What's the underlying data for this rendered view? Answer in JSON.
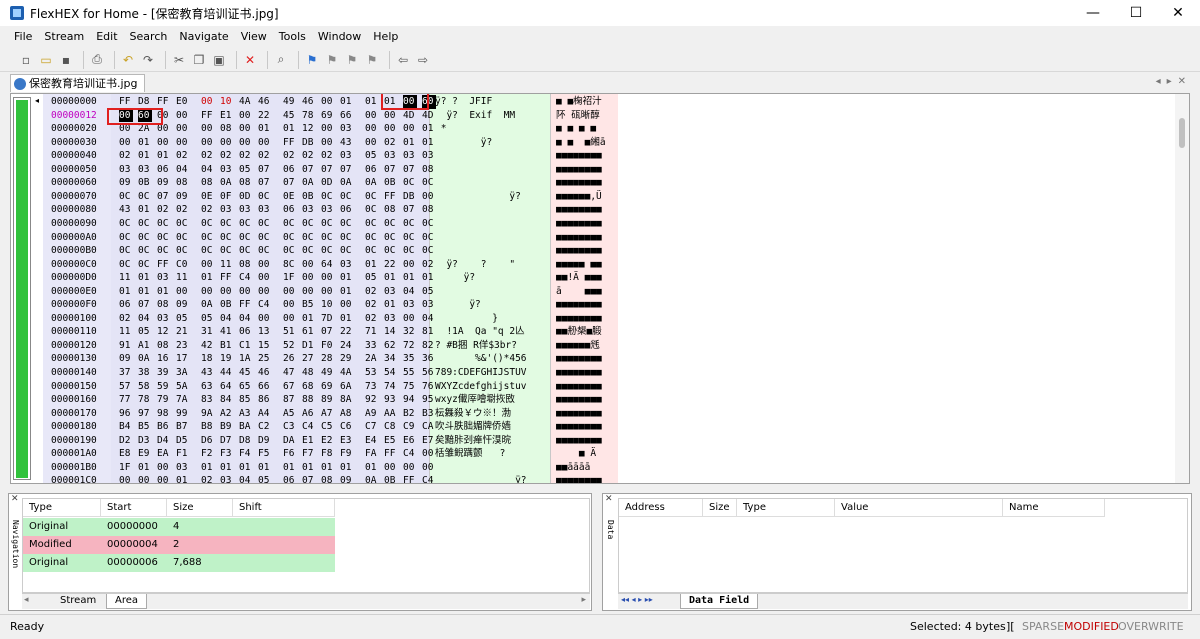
{
  "window": {
    "title": "FlexHEX for Home - [保密教育培训证书.jpg]",
    "controls": [
      "—",
      "☐",
      "✕"
    ]
  },
  "menu": [
    "File",
    "Stream",
    "Edit",
    "Search",
    "Navigate",
    "View",
    "Tools",
    "Window",
    "Help"
  ],
  "toolbar_icons": [
    "new-icon",
    "open-icon",
    "save-icon",
    "print-icon",
    "undo-icon",
    "redo-icon",
    "cut-icon",
    "copy-icon",
    "paste-icon",
    "delete-icon",
    "find-icon",
    "bookmark-icon",
    "bookmark-next-icon",
    "bookmark-prev-icon",
    "bookmark-clear-icon",
    "back-icon",
    "forward-icon"
  ],
  "document_tab": "保密教育培训证书.jpg",
  "hex_rows": [
    {
      "addr": "00000000",
      "hex": [
        "FF",
        "D8",
        "FF",
        "E0",
        "00",
        "10",
        "4A",
        "46",
        "49",
        "46",
        "00",
        "01",
        "01",
        "01",
        "00",
        "60"
      ],
      "ascii": "ÿ? ?  JFIF  ",
      "uni": "■ ■椈祒汁"
    },
    {
      "addr": "00000012",
      "hex": [
        "00",
        "60",
        "00",
        "00",
        "FF",
        "E1",
        "00",
        "22",
        "45",
        "78",
        "69",
        "66",
        "00",
        "00",
        "4D",
        "4D"
      ],
      "ascii": "  ÿ?  Exif  MM",
      "uni": "阫 砙晰醇"
    },
    {
      "addr": "00000020",
      "hex": [
        "00",
        "2A",
        "00",
        "00",
        "00",
        "08",
        "00",
        "01",
        "01",
        "12",
        "00",
        "03",
        "00",
        "00",
        "00",
        "01"
      ],
      "ascii": " *",
      "uni": "■ ■ ■ ■"
    },
    {
      "addr": "00000030",
      "hex": [
        "00",
        "01",
        "00",
        "00",
        "00",
        "00",
        "00",
        "00",
        "FF",
        "DB",
        "00",
        "43",
        "00",
        "02",
        "01",
        "01"
      ],
      "ascii": "        ÿ?",
      "uni": "■ ■  ■緗ā"
    },
    {
      "addr": "00000040",
      "hex": [
        "02",
        "01",
        "01",
        "02",
        "02",
        "02",
        "02",
        "02",
        "02",
        "02",
        "02",
        "03",
        "05",
        "03",
        "03",
        "03"
      ],
      "ascii": "",
      "uni": "■■■■■■■■"
    },
    {
      "addr": "00000050",
      "hex": [
        "03",
        "03",
        "06",
        "04",
        "04",
        "03",
        "05",
        "07",
        "06",
        "07",
        "07",
        "07",
        "06",
        "07",
        "07",
        "08"
      ],
      "ascii": "",
      "uni": "■■■■■■■■"
    },
    {
      "addr": "00000060",
      "hex": [
        "09",
        "0B",
        "09",
        "08",
        "08",
        "0A",
        "08",
        "07",
        "07",
        "0A",
        "0D",
        "0A",
        "0A",
        "0B",
        "0C",
        "0C"
      ],
      "ascii": "",
      "uni": "■■■■■■■■"
    },
    {
      "addr": "00000070",
      "hex": [
        "0C",
        "0C",
        "07",
        "09",
        "0E",
        "0F",
        "0D",
        "0C",
        "0E",
        "0B",
        "0C",
        "0C",
        "0C",
        "FF",
        "DB",
        "00"
      ],
      "ascii": "             ÿ?",
      "uni": "■■■■■■,Ü"
    },
    {
      "addr": "00000080",
      "hex": [
        "43",
        "01",
        "02",
        "02",
        "02",
        "03",
        "03",
        "03",
        "06",
        "03",
        "03",
        "06",
        "0C",
        "08",
        "07",
        "08"
      ],
      "ascii": "",
      "uni": "■■■■■■■■"
    },
    {
      "addr": "00000090",
      "hex": [
        "0C",
        "0C",
        "0C",
        "0C",
        "0C",
        "0C",
        "0C",
        "0C",
        "0C",
        "0C",
        "0C",
        "0C",
        "0C",
        "0C",
        "0C",
        "0C"
      ],
      "ascii": "",
      "uni": "■■■■■■■■"
    },
    {
      "addr": "000000A0",
      "hex": [
        "0C",
        "0C",
        "0C",
        "0C",
        "0C",
        "0C",
        "0C",
        "0C",
        "0C",
        "0C",
        "0C",
        "0C",
        "0C",
        "0C",
        "0C",
        "0C"
      ],
      "ascii": "",
      "uni": "■■■■■■■■"
    },
    {
      "addr": "000000B0",
      "hex": [
        "0C",
        "0C",
        "0C",
        "0C",
        "0C",
        "0C",
        "0C",
        "0C",
        "0C",
        "0C",
        "0C",
        "0C",
        "0C",
        "0C",
        "0C",
        "0C"
      ],
      "ascii": "",
      "uni": "■■■■■■■■"
    },
    {
      "addr": "000000C0",
      "hex": [
        "0C",
        "0C",
        "FF",
        "C0",
        "00",
        "11",
        "08",
        "00",
        "8C",
        "00",
        "64",
        "03",
        "01",
        "22",
        "00",
        "02"
      ],
      "ascii": "  ÿ?    ?    \"",
      "uni": "■■■■■ ■■"
    },
    {
      "addr": "000000D0",
      "hex": [
        "11",
        "01",
        "03",
        "11",
        "01",
        "FF",
        "C4",
        "00",
        "1F",
        "00",
        "00",
        "01",
        "05",
        "01",
        "01",
        "01"
      ],
      "ascii": "     ÿ?",
      "uni": "■■!Ä ■■■"
    },
    {
      "addr": "000000E0",
      "hex": [
        "01",
        "01",
        "01",
        "00",
        "00",
        "00",
        "00",
        "00",
        "00",
        "00",
        "00",
        "01",
        "02",
        "03",
        "04",
        "05"
      ],
      "ascii": "",
      "uni": "ā    ■■■"
    },
    {
      "addr": "000000F0",
      "hex": [
        "06",
        "07",
        "08",
        "09",
        "0A",
        "0B",
        "FF",
        "C4",
        "00",
        "B5",
        "10",
        "00",
        "02",
        "01",
        "03",
        "03"
      ],
      "ascii": "      ÿ?",
      "uni": "■■■■■■■■"
    },
    {
      "addr": "00000100",
      "hex": [
        "02",
        "04",
        "03",
        "05",
        "05",
        "04",
        "04",
        "00",
        "00",
        "01",
        "7D",
        "01",
        "02",
        "03",
        "00",
        "04"
      ],
      "ascii": "          }",
      "uni": "■■■■■■■■"
    },
    {
      "addr": "00000110",
      "hex": [
        "11",
        "05",
        "12",
        "21",
        "31",
        "41",
        "06",
        "13",
        "51",
        "61",
        "07",
        "22",
        "71",
        "14",
        "32",
        "81"
      ],
      "ascii": "  !1A  Qa \"q 2亾",
      "uni": "■■刱槼■腶"
    },
    {
      "addr": "00000120",
      "hex": [
        "91",
        "A1",
        "08",
        "23",
        "42",
        "B1",
        "C1",
        "15",
        "52",
        "D1",
        "F0",
        "24",
        "33",
        "62",
        "72",
        "82"
      ],
      "ascii": "? #B捆 R佯$3br?",
      "uni": "■■■■■■毤"
    },
    {
      "addr": "00000130",
      "hex": [
        "09",
        "0A",
        "16",
        "17",
        "18",
        "19",
        "1A",
        "25",
        "26",
        "27",
        "28",
        "29",
        "2A",
        "34",
        "35",
        "36"
      ],
      "ascii": "       %&'()*456",
      "uni": "■■■■■■■■"
    },
    {
      "addr": "00000140",
      "hex": [
        "37",
        "38",
        "39",
        "3A",
        "43",
        "44",
        "45",
        "46",
        "47",
        "48",
        "49",
        "4A",
        "53",
        "54",
        "55",
        "56"
      ],
      "ascii": "789:CDEFGHIJSTUV",
      "uni": "■■■■■■■■"
    },
    {
      "addr": "00000150",
      "hex": [
        "57",
        "58",
        "59",
        "5A",
        "63",
        "64",
        "65",
        "66",
        "67",
        "68",
        "69",
        "6A",
        "73",
        "74",
        "75",
        "76"
      ],
      "ascii": "WXYZcdefghijstuv",
      "uni": "■■■■■■■■"
    },
    {
      "addr": "00000160",
      "hex": [
        "77",
        "78",
        "79",
        "7A",
        "83",
        "84",
        "85",
        "86",
        "87",
        "88",
        "89",
        "8A",
        "92",
        "93",
        "94",
        "95"
      ],
      "ascii": "wxyz儎厗噲墛拻敃",
      "uni": "■■■■■■■■"
    },
    {
      "addr": "00000170",
      "hex": [
        "96",
        "97",
        "98",
        "99",
        "9A",
        "A2",
        "A3",
        "A4",
        "A5",
        "A6",
        "A7",
        "A8",
        "A9",
        "AA",
        "B2",
        "B3"
      ],
      "ascii": "枟橆殺￥ウ※！渤",
      "uni": "■■■■■■■■"
    },
    {
      "addr": "00000180",
      "hex": [
        "B4",
        "B5",
        "B6",
        "B7",
        "B8",
        "B9",
        "BA",
        "C2",
        "C3",
        "C4",
        "C5",
        "C6",
        "C7",
        "C8",
        "C9",
        "CA"
      ],
      "ascii": "吹斗胅胐媚牌侨嫱",
      "uni": "■■■■■■■■"
    },
    {
      "addr": "00000190",
      "hex": [
        "D2",
        "D3",
        "D4",
        "D5",
        "D6",
        "D7",
        "D8",
        "D9",
        "DA",
        "E1",
        "E2",
        "E3",
        "E4",
        "E5",
        "E6",
        "E7"
      ],
      "ascii": "矣黯胩刭瘅忓湨晥",
      "uni": "■■■■■■■■"
    },
    {
      "addr": "000001A0",
      "hex": [
        "E8",
        "E9",
        "EA",
        "F1",
        "F2",
        "F3",
        "F4",
        "F5",
        "F6",
        "F7",
        "F8",
        "F9",
        "FA",
        "FF",
        "C4",
        "00"
      ],
      "ascii": "栝雏鲵蹒颤   ?",
      "uni": "    ■ Ä"
    },
    {
      "addr": "000001B0",
      "hex": [
        "1F",
        "01",
        "00",
        "03",
        "01",
        "01",
        "01",
        "01",
        "01",
        "01",
        "01",
        "01",
        "01",
        "00",
        "00",
        "00"
      ],
      "ascii": "",
      "uni": "■■āāāā"
    },
    {
      "addr": "000001C0",
      "hex": [
        "00",
        "00",
        "00",
        "01",
        "02",
        "03",
        "04",
        "05",
        "06",
        "07",
        "08",
        "09",
        "0A",
        "0B",
        "FF",
        "C4"
      ],
      "ascii": "              ÿ?",
      "uni": "■■■■■■■■"
    }
  ],
  "navigation_panel": {
    "label": "Navigation",
    "columns": [
      "Type",
      "Start",
      "Size",
      "Shift"
    ],
    "rows": [
      {
        "type": "Original",
        "start": "00000000",
        "size": "4",
        "shift": "",
        "color": "#bff2c8"
      },
      {
        "type": "Modified",
        "start": "00000004",
        "size": "2",
        "shift": "",
        "color": "#f6b4c0"
      },
      {
        "type": "Original",
        "start": "00000006",
        "size": "7,688",
        "shift": "",
        "color": "#bff2c8"
      }
    ],
    "tabs": [
      "Stream",
      "Area"
    ]
  },
  "data_panel": {
    "label": "Data",
    "columns": [
      "Address",
      "Size",
      "Type",
      "Value",
      "Name"
    ],
    "tab": "Data Field",
    "nav_arrows": "◂◂ ◂ ▸ ▸▸"
  },
  "status": {
    "ready": "Ready",
    "selected": "Selected: 4 bytes",
    "separator": "][",
    "sparse": "SPARSE",
    "modified": "MODIFIED",
    "overwrite": "OVERWRITE"
  },
  "colors": {
    "modified_hex": "#d00000",
    "nav_green": "#31c23c",
    "highlight_red": "#e02020"
  }
}
